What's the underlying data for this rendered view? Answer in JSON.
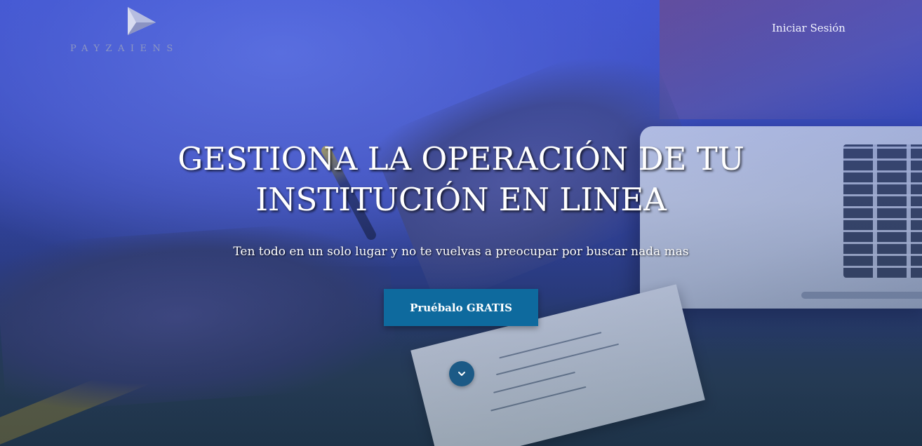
{
  "brand": {
    "name": "PAYZAIENS",
    "logo_icon": "paper-plane-triangle-icon"
  },
  "nav": {
    "login_label": "Iniciar Sesión"
  },
  "hero": {
    "title_line1": "GESTIONA LA OPERACIÓN DE TU",
    "title_line2": "INSTITUCIÓN EN LINEA",
    "subtitle": "Ten todo en un solo lugar y no te vuelvas a preocupar por buscar nada mas",
    "cta_label": "Pruébalo GRATIS",
    "scroll_icon": "chevron-down-icon"
  },
  "colors": {
    "cta_background": "#0e6a9e",
    "scroll_button": "#1c5a86",
    "overlay_tint": "#3b4cb6",
    "text": "#ffffff"
  }
}
